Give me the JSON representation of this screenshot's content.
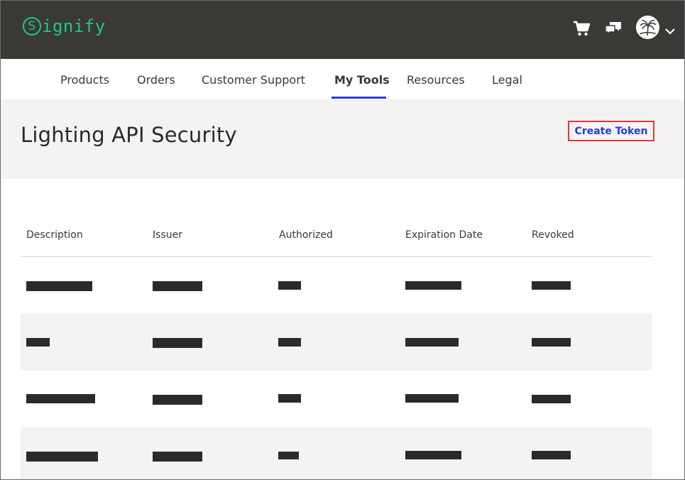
{
  "brand": {
    "logo_letter": "S",
    "logo_text": "ignify",
    "accent": "#1ec78b",
    "header_bg": "#3b3935"
  },
  "header_icons": [
    "cart-icon",
    "chat-icon",
    "avatar",
    "chevron-down-icon"
  ],
  "nav": {
    "items": [
      {
        "label": "Products"
      },
      {
        "label": "Orders"
      },
      {
        "label": "Customer Support"
      },
      {
        "label": "My Tools",
        "active": true
      },
      {
        "label": "Resources"
      },
      {
        "label": "Legal"
      }
    ],
    "active_color": "#1f3fd6"
  },
  "page": {
    "title": "Lighting API Security",
    "create_button": "Create Token",
    "highlight_color": "#e0393e"
  },
  "table": {
    "columns": [
      "Description",
      "Issuer",
      "Authorized",
      "Expiration Date",
      "Revoked"
    ],
    "rows_note_redacted": true,
    "row_count": 4
  }
}
